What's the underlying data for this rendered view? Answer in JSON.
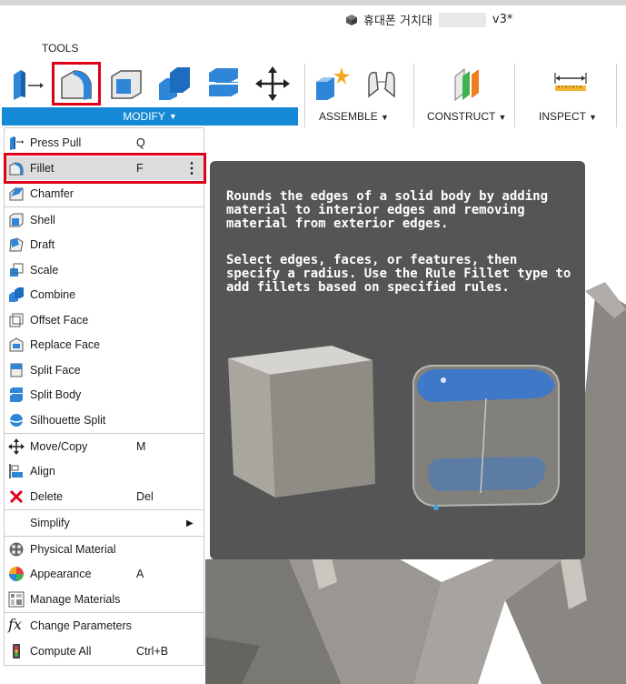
{
  "document": {
    "title": "휴대폰 거치대",
    "version": "v3*"
  },
  "toolbar": {
    "tools_label": "TOOLS",
    "groups": {
      "modify": "MODIFY",
      "assemble": "ASSEMBLE",
      "construct": "CONSTRUCT",
      "inspect": "INSPECT"
    }
  },
  "menu": {
    "items": [
      {
        "label": "Press Pull",
        "shortcut": "Q",
        "icon": "press-pull-icon"
      },
      {
        "label": "Fillet",
        "shortcut": "F",
        "icon": "fillet-icon",
        "selected": true
      },
      {
        "label": "Chamfer",
        "shortcut": "",
        "icon": "chamfer-icon"
      },
      {
        "label": "Shell",
        "shortcut": "",
        "icon": "shell-icon"
      },
      {
        "label": "Draft",
        "shortcut": "",
        "icon": "draft-icon"
      },
      {
        "label": "Scale",
        "shortcut": "",
        "icon": "scale-icon"
      },
      {
        "label": "Combine",
        "shortcut": "",
        "icon": "combine-icon"
      },
      {
        "label": "Offset Face",
        "shortcut": "",
        "icon": "offset-face-icon"
      },
      {
        "label": "Replace Face",
        "shortcut": "",
        "icon": "replace-face-icon"
      },
      {
        "label": "Split Face",
        "shortcut": "",
        "icon": "split-face-icon"
      },
      {
        "label": "Split Body",
        "shortcut": "",
        "icon": "split-body-icon"
      },
      {
        "label": "Silhouette Split",
        "shortcut": "",
        "icon": "silhouette-split-icon"
      },
      {
        "label": "Move/Copy",
        "shortcut": "M",
        "icon": "move-icon"
      },
      {
        "label": "Align",
        "shortcut": "",
        "icon": "align-icon"
      },
      {
        "label": "Delete",
        "shortcut": "Del",
        "icon": "delete-icon"
      },
      {
        "label": "Simplify",
        "shortcut": "",
        "icon": "",
        "submenu": true
      },
      {
        "label": "Physical Material",
        "shortcut": "",
        "icon": "physical-material-icon"
      },
      {
        "label": "Appearance",
        "shortcut": "A",
        "icon": "appearance-icon"
      },
      {
        "label": "Manage Materials",
        "shortcut": "",
        "icon": "manage-materials-icon"
      },
      {
        "label": "Change Parameters",
        "shortcut": "",
        "icon": "fx-icon"
      },
      {
        "label": "Compute All",
        "shortcut": "Ctrl+B",
        "icon": "compute-all-icon"
      }
    ]
  },
  "tooltip": {
    "paragraph1": "Rounds the edges of a solid body by adding\nmaterial to interior edges and removing\nmaterial from exterior edges.",
    "paragraph2": "Select edges, faces, or features, then\nspecify a radius. Use the Rule Fillet type to\nadd fillets based on specified rules."
  },
  "colors": {
    "accent": "#1589d6",
    "highlight": "#e0001a",
    "tooltip_bg": "#555555",
    "face_blue": "#3f78c8"
  }
}
